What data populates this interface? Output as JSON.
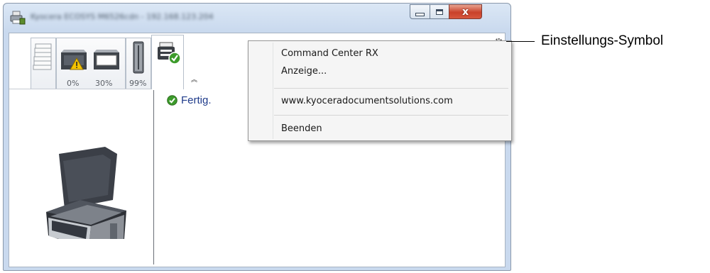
{
  "window": {
    "title": "Kyocera ECOSYS M6526cdn  -  192.168.123.204",
    "buttons": {
      "minimize": "—",
      "maximize": "☐",
      "close": "x"
    }
  },
  "tabs": {
    "toner_levels": [
      "0%",
      "30%",
      "99%"
    ],
    "icons": [
      "paper-stack-icon",
      "toner-warning-icon",
      "toner-icon",
      "waste-toner-box-icon",
      "printer-status-icon"
    ]
  },
  "status": {
    "message": "Fertig.",
    "status_color": "#1e3a8a"
  },
  "context_menu": {
    "items": [
      "Command Center RX",
      "Anzeige...",
      "www.kyoceradocumentsolutions.com",
      "Beenden"
    ]
  },
  "annotation": {
    "label": "Einstellungs-Symbol"
  }
}
